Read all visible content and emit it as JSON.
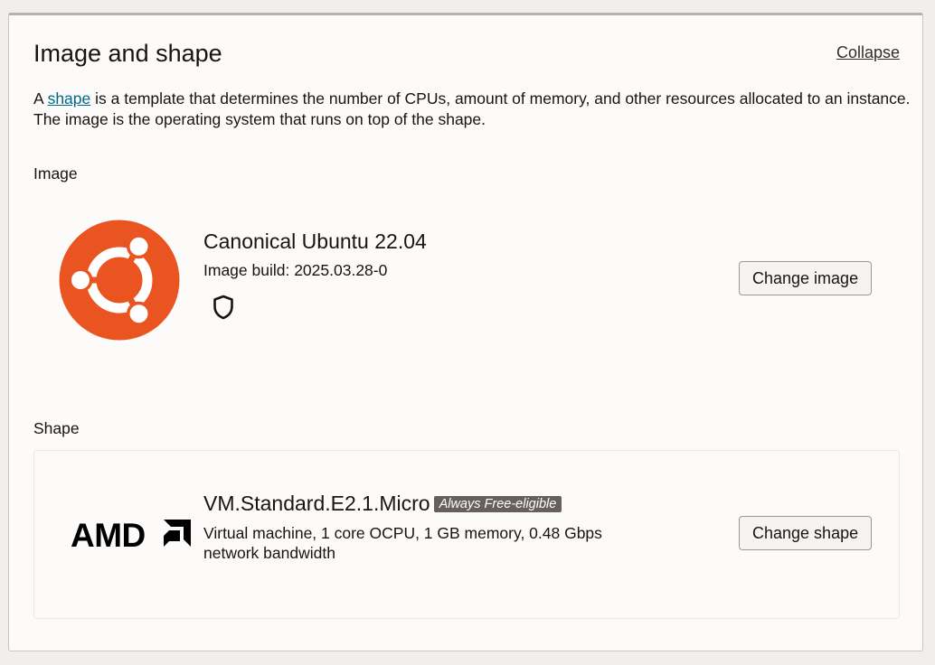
{
  "section": {
    "title": "Image and shape",
    "collapse_label": "Collapse",
    "description_prefix": "A ",
    "description_link": "shape",
    "description_suffix": " is a template that determines the number of CPUs, amount of memory, and other resources allocated to an instance. The image is the operating system that runs on top of the shape."
  },
  "image": {
    "label": "Image",
    "name": "Canonical Ubuntu 22.04",
    "build": "Image build: 2025.03.28-0",
    "logo_icon": "ubuntu-logo",
    "security_icon": "shield-icon",
    "change_button": "Change image",
    "brand_color": "#e95420"
  },
  "shape": {
    "label": "Shape",
    "name": "VM.Standard.E2.1.Micro",
    "badge": "Always Free-eligible",
    "details": "Virtual machine, 1 core OCPU, 1 GB memory, 0.48 Gbps network bandwidth",
    "logo_icon": "amd-logo",
    "change_button": "Change shape"
  }
}
